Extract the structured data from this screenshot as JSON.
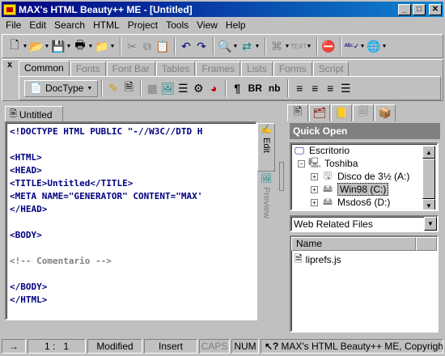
{
  "window": {
    "title": "MAX's HTML Beauty++ ME - [Untitled]",
    "minimize": "_",
    "maximize": "□",
    "close": "✕"
  },
  "menu": [
    "File",
    "Edit",
    "Search",
    "HTML",
    "Project",
    "Tools",
    "View",
    "Help"
  ],
  "toolbar": {
    "icons": [
      "new-file-icon",
      "open-folder-icon",
      "save-icon",
      "print-icon",
      "folder-icon",
      "cut-icon",
      "copy-icon",
      "paste-icon",
      "undo-icon",
      "redo-icon",
      "find-icon",
      "replace-icon",
      "tag-icon",
      "text-icon",
      "stop-icon",
      "spell-check-icon",
      "browser-icon"
    ]
  },
  "tool_tabs": {
    "close": "x",
    "tabs": [
      "Common",
      "Fonts",
      "Font Bar",
      "Tables",
      "Frames",
      "Lists",
      "Forms",
      "Script"
    ],
    "active": "Common",
    "doctype_label": "DocType",
    "bold_label": "BR",
    "nb_label": "nb",
    "para_label": "¶"
  },
  "document": {
    "tab_label": "Untitled",
    "code_lines": [
      {
        "t": "<!DOCTYPE HTML PUBLIC \"-//W3C//DTD H",
        "k": "tag"
      },
      {
        "t": "",
        "k": "tag"
      },
      {
        "t": "<HTML>",
        "k": "tag"
      },
      {
        "t": "<HEAD>",
        "k": "tag"
      },
      {
        "t": "<TITLE>Untitled</TITLE>",
        "k": "tag"
      },
      {
        "t": "<META NAME=\"GENERATOR\" CONTENT=\"MAX'",
        "k": "tag"
      },
      {
        "t": "</HEAD>",
        "k": "tag"
      },
      {
        "t": "",
        "k": "tag"
      },
      {
        "t": "<BODY>",
        "k": "tag"
      },
      {
        "t": "",
        "k": "tag"
      },
      {
        "t": "<!-- Comentario -->",
        "k": "comment"
      },
      {
        "t": "",
        "k": "tag"
      },
      {
        "t": "</BODY>",
        "k": "tag"
      },
      {
        "t": "</HTML>",
        "k": "tag"
      }
    ],
    "view_tabs": {
      "edit": "Edit",
      "preview": "Preview"
    }
  },
  "right_panel": {
    "title": "Quick Open",
    "tree": [
      {
        "label": "Escritorio",
        "indent": 0,
        "icon": "desktop-icon",
        "toggle": ""
      },
      {
        "label": "Toshiba",
        "indent": 1,
        "icon": "computer-icon",
        "toggle": "−"
      },
      {
        "label": "Disco de 3½ (A:)",
        "indent": 2,
        "icon": "floppy-icon",
        "toggle": "+"
      },
      {
        "label": "Win98 (C:)",
        "indent": 2,
        "icon": "drive-icon",
        "toggle": "+",
        "selected": true
      },
      {
        "label": "Msdos6 (D:)",
        "indent": 2,
        "icon": "drive-icon",
        "toggle": "+"
      }
    ],
    "filter": "Web Related Files",
    "list_header": "Name",
    "files": [
      "liprefs.js"
    ]
  },
  "statusbar": {
    "arrow": "→",
    "position": "1 :   1",
    "modified": "Modified",
    "insert": "Insert",
    "caps": "CAPS",
    "num": "NUM",
    "message": "MAX's HTML Beauty++ ME, Copyright ©"
  }
}
